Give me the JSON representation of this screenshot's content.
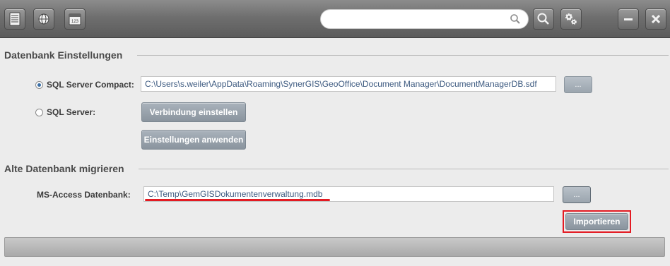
{
  "toolbar": {
    "search": {
      "value": "",
      "placeholder": ""
    }
  },
  "db_settings": {
    "title": "Datenbank Einstellungen",
    "sql_compact_label": "SQL Server Compact:",
    "sql_compact_path": "C:\\Users\\s.weiler\\AppData\\Roaming\\SynerGIS\\GeoOffice\\Document Manager\\DocumentManagerDB.sdf",
    "browse_label": "...",
    "sql_server_label": "SQL Server:",
    "connect_button": "Verbindung einstellen",
    "apply_button": "Einstellungen anwenden",
    "selected_option": "SQL Server Compact"
  },
  "migrate": {
    "title": "Alte Datenbank migrieren",
    "access_label": "MS-Access Datenbank:",
    "access_path": "C:\\Temp\\GemGISDokumentenverwaltung.mdb",
    "browse_label": "...",
    "import_button": "Importieren"
  },
  "progress": {
    "value": 0
  },
  "colors": {
    "highlight": "#e31b23",
    "button": "#9aa4ad",
    "path_text": "#3d5a80"
  }
}
